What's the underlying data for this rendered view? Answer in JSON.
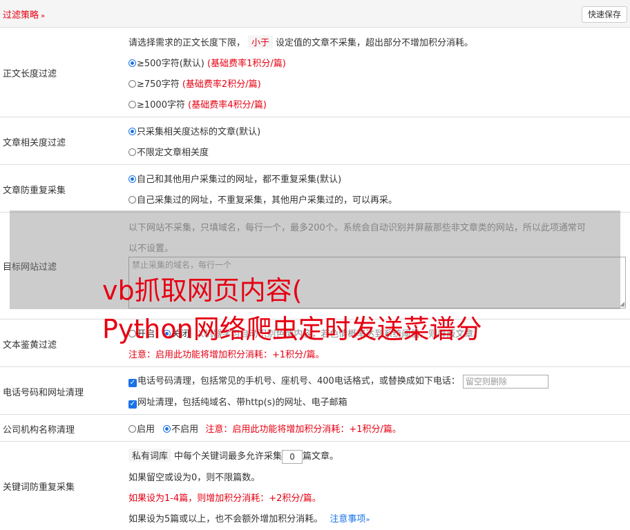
{
  "header": {
    "title": "过滤策略",
    "chevron": "»",
    "save_label": "快速保存"
  },
  "length_filter": {
    "label": "正文长度过滤",
    "desc_pre": "请选择需求的正文长度下限，",
    "desc_pill": "小于",
    "desc_post": "设定值的文章不采集，超出部分不增加积分消耗。",
    "options": [
      {
        "text": "≥500字符(默认)",
        "note": "(基础费率1积分/篇)",
        "checked": true
      },
      {
        "text": "≥750字符",
        "note": "(基础费率2积分/篇)",
        "checked": false
      },
      {
        "text": "≥1000字符",
        "note": "(基础费率4积分/篇)",
        "checked": false
      }
    ]
  },
  "relevance": {
    "label": "文章相关度过滤",
    "options": [
      {
        "text": "只采集相关度达标的文章(默认)",
        "checked": true
      },
      {
        "text": "不限定文章相关度",
        "checked": false
      }
    ]
  },
  "dedupe": {
    "label": "文章防重复采集",
    "options": [
      {
        "text": "自己和其他用户采集过的网址，都不重复采集(默认)",
        "checked": true
      },
      {
        "text": "自己采集过的网址，不重复采集，其他用户采集过的，可以再采。",
        "checked": false
      }
    ]
  },
  "site_filter": {
    "label": "目标网站过滤",
    "desc_line1": "以下网站不采集，只填域名，每行一个，最多200个。系统会自动识别并屏蔽那些非文章类的网站，所以此项通常可",
    "desc_line2": "以不设置。",
    "placeholder": "禁止采集的域名，每行一个"
  },
  "porn_filter": {
    "label": "文本鉴黄过滤",
    "opt_on": "开启",
    "opt_off": "关闭",
    "desc": "以机器学习自动识别色情内容，若色情概率达到系统阈值，则屏蔽文章。",
    "note": "注意：启用此功能将增加积分消耗：+1积分/篇。"
  },
  "phone_clean": {
    "label": "电话号码和网址清理",
    "phone_text": "电话号码清理，包括常见的手机号、座机号、400电话格式，或替换成如下电话：",
    "phone_placeholder": "留空则删除",
    "url_text": "网址清理，包括纯域名、带http(s)的网址、电子邮箱"
  },
  "company_clean": {
    "label": "公司机构名称清理",
    "opt_on": "启用",
    "opt_off": "不启用",
    "note": "注意：启用此功能将增加积分消耗：+1积分/篇。"
  },
  "keyword_dedupe": {
    "label": "关键词防重复采集",
    "pill": "私有词库",
    "line1_mid": "中每个关键词最多允许采集",
    "count_value": "0",
    "line1_end": "篇文章。",
    "line2": "如果留空或设为0，则不限篇数。",
    "line3": "如果设为1-4篇，则增加积分消耗：+2积分/篇。",
    "line4": "如果设为5篇或以上，也不会额外增加积分消耗。",
    "link": "注意事项",
    "link_chevron": "»"
  },
  "watermark": {
    "line1": "vb抓取网页内容(",
    "line2": "Python网络爬虫定时发送菜谱分"
  },
  "colors": {
    "accent_red": "#e60012",
    "accent_blue": "#1a73e8"
  }
}
